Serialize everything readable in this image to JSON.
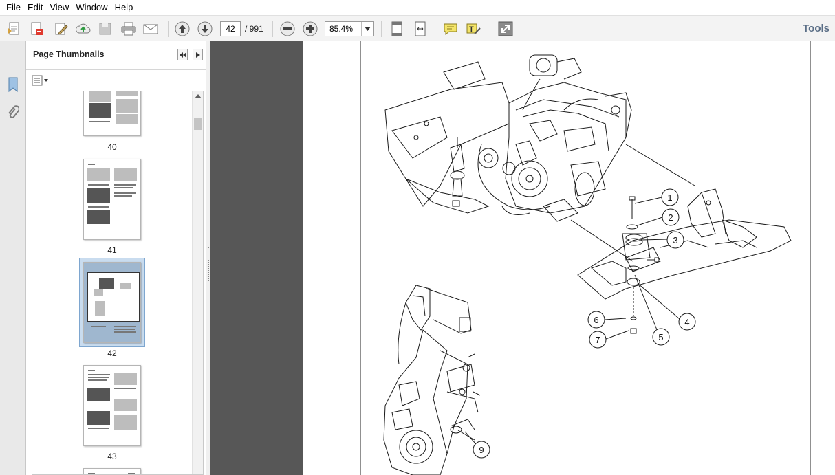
{
  "menu": [
    "File",
    "Edit",
    "View",
    "Window",
    "Help"
  ],
  "toolbar": {
    "page_current": "42",
    "page_total": "/  991",
    "zoom": "85.4%",
    "tools_label": "Tools"
  },
  "panel": {
    "title": "Page Thumbnails"
  },
  "thumbnails": [
    {
      "label": "40"
    },
    {
      "label": "41"
    },
    {
      "label": "42"
    },
    {
      "label": "43"
    }
  ],
  "callouts": [
    "1",
    "2",
    "3",
    "4",
    "5",
    "6",
    "7",
    "9"
  ],
  "colors": {
    "accent": "#5a6e86",
    "doc_background": "#575757",
    "selection": "#c9dcef"
  }
}
